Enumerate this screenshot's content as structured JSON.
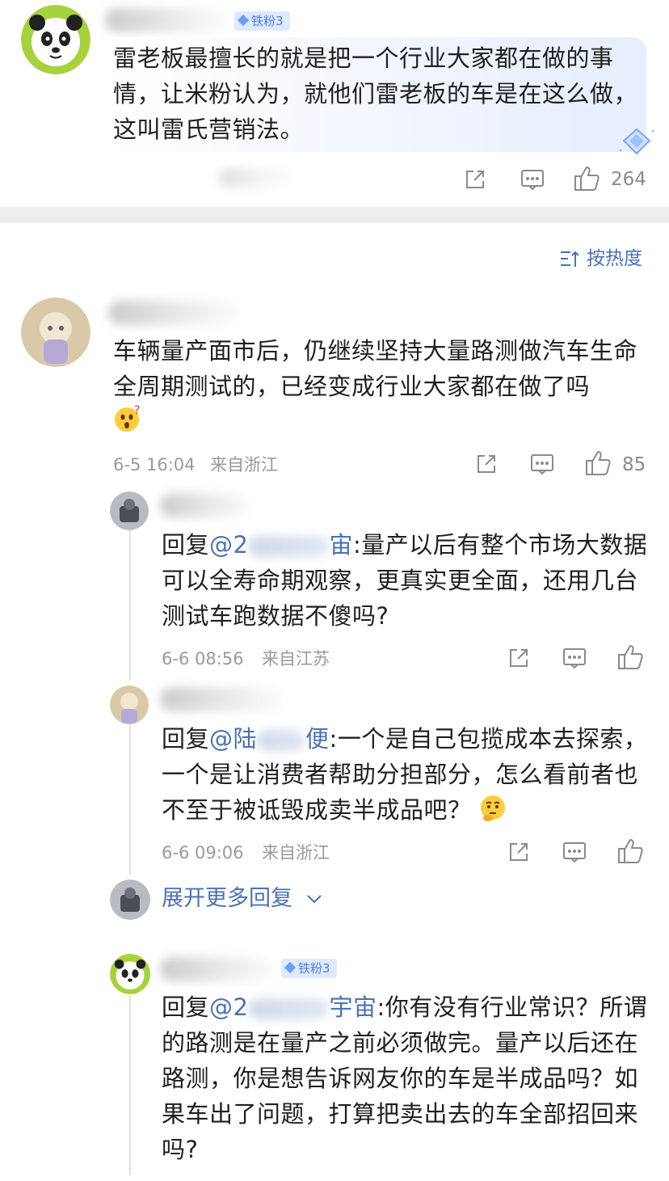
{
  "top_comment": {
    "badge": "铁粉3",
    "text": "雷老板最擅长的就是把一个行业大家都在做的事情，让米粉认为，就他们雷老板的车是在这么做，这叫雷氏营销法。",
    "likes": "264"
  },
  "sort_label": "按热度",
  "main_comment": {
    "text": "车辆量产面市后，仍继续坚持大量路测做汽车生命全周期测试的，已经变成行业大家都在做了吗",
    "time": "6-5 16:04",
    "location": "来自浙江",
    "likes": "85"
  },
  "replies": [
    {
      "prefix": "回复",
      "mention": "@2",
      "mention_tail": "宙",
      "text": ":量产以后有整个市场大数据可以全寿命期观察，更真实更全面，还用几台测试车跑数据不傻吗?",
      "time": "6-6 08:56",
      "location": "来自江苏"
    },
    {
      "prefix": "回复",
      "mention": "@陆",
      "mention_tail": "便",
      "text": ":一个是自己包揽成本去探索，一个是让消费者帮助分担部分，怎么看前者也不至于被诋毁成卖半成品吧？",
      "time": "6-6 09:06",
      "location": "来自浙江"
    },
    {
      "badge": "铁粉3",
      "prefix": "回复",
      "mention": "@2",
      "mention_tail": "宇宙",
      "text": ":你有没有行业常识？所谓的路测是在量产之前必须做完。量产以后还在路测，你是想告诉网友你的车是半成品吗？如果车出了问题，打算把卖出去的车全部招回来吗?"
    }
  ],
  "expand_label": "展开更多回复",
  "colors": {
    "link": "#4a72b5",
    "meta": "#9a9a9a",
    "badge_bg": "#dfe9ff",
    "badge_fg": "#4e7ee8"
  },
  "icons": [
    "share-icon",
    "comment-icon",
    "like-icon",
    "sort-icon",
    "chevron-down-icon",
    "emoji-thinking",
    "emoji-shocked",
    "panda-avatar"
  ]
}
